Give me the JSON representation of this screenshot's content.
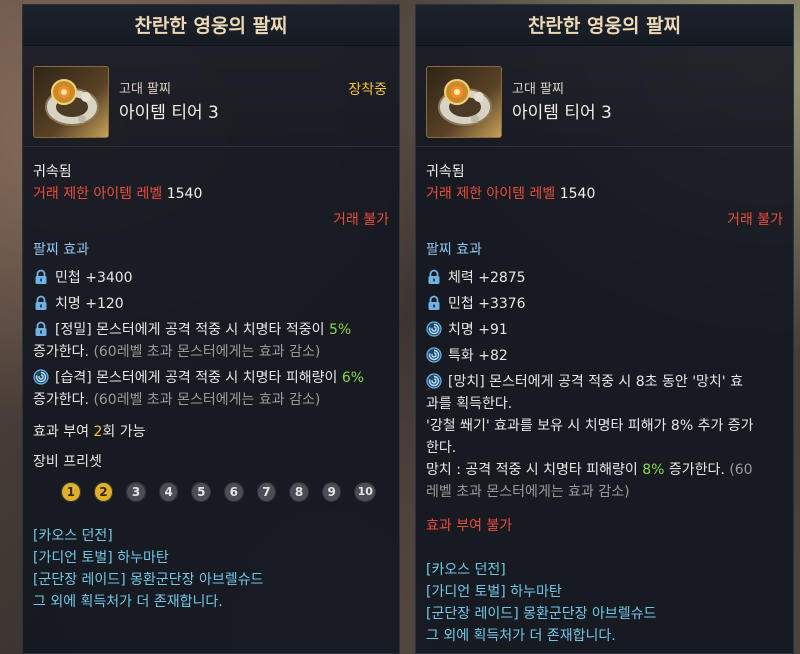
{
  "left": {
    "title": "찬란한 영웅의 팔찌",
    "grade": "고대 팔찌",
    "tier": "아이템 티어 3",
    "equipped": "장착중",
    "bound": "귀속됨",
    "trade_req_label": "거래 제한 아이템 레벨",
    "trade_req_value": "1540",
    "trade_status": "거래 불가",
    "effects_title": "팔찌 효과",
    "stats": [
      {
        "icon": "lock-icon",
        "text": "민첩 +3400"
      },
      {
        "icon": "lock-icon",
        "text": "치명 +120"
      }
    ],
    "special1": {
      "tag": "[정밀]",
      "text": "몬스터에게 공격 적중 시 치명타 적중이",
      "value": "5%",
      "text2": "증가한다.",
      "note": "(60레벨 초과 몬스터에게는 효과 감소)"
    },
    "special2": {
      "tag": "[습격]",
      "text": "몬스터에게 공격 적중 시 치명타 피해량이",
      "value": "6%",
      "text2": "증가한다.",
      "note": "(60레벨 초과 몬스터에게는 효과 감소)"
    },
    "enchant_prefix": "효과 부여",
    "enchant_count": "2",
    "enchant_suffix": "회 가능",
    "preset_title": "장비 프리셋",
    "presets": [
      "1",
      "2",
      "3",
      "4",
      "5",
      "6",
      "7",
      "8",
      "9",
      "10"
    ],
    "preset_active_count": 2,
    "sources": [
      "[카오스 던전]",
      "[가디언 토벌] 하누마탄",
      "[군단장 레이드] 몽환군단장 아브렐슈드",
      "그 외에 획득처가 더 존재합니다."
    ]
  },
  "right": {
    "title": "찬란한 영웅의 팔찌",
    "grade": "고대 팔찌",
    "tier": "아이템 티어 3",
    "bound": "귀속됨",
    "trade_req_label": "거래 제한 아이템 레벨",
    "trade_req_value": "1540",
    "trade_status": "거래 불가",
    "effects_title": "팔찌 효과",
    "stats": [
      {
        "icon": "lock-icon",
        "text": "체력 +2875"
      },
      {
        "icon": "lock-icon",
        "text": "민첩 +3376"
      },
      {
        "icon": "swirl-icon",
        "text": "치명 +91"
      },
      {
        "icon": "swirl-icon",
        "text": "특화 +82"
      }
    ],
    "special": {
      "tag": "[망치]",
      "line1": "몬스터에게 공격 적중 시 8초 동안 '망치' 효",
      "line2": "과를 획득한다.",
      "line3": "'강철 쐐기' 효과를 보유 시 치명타 피해가 8% 추가 증가",
      "line4": "한다.",
      "line5_prefix": "망치 : 공격 적중 시 치명타 피해량이",
      "line5_value": "8%",
      "line5_suffix": "증가한다.",
      "line5_note": "(60",
      "line6": "레벨 초과 몬스터에게는 효과 감소)"
    },
    "enchant_status": "효과 부여 불가",
    "sources": [
      "[카오스 던전]",
      "[가디언 토벌] 하누마탄",
      "[군단장 레이드] 몽환군단장 아브렐슈드",
      "그 외에 획득처가 더 존재합니다."
    ]
  }
}
